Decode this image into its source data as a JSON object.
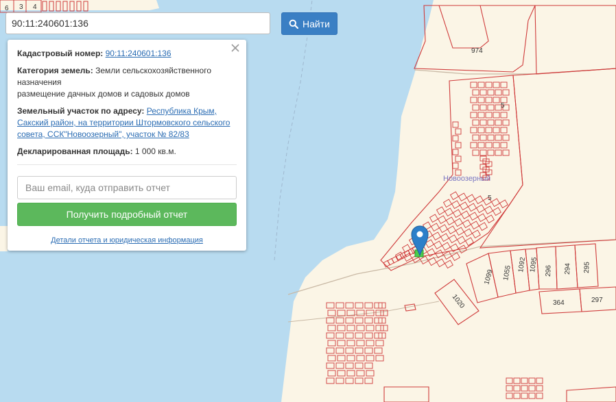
{
  "search": {
    "value": "90:11:240601:136",
    "button_label": "Найти"
  },
  "info": {
    "cadastral_label": "Кадастровый номер:",
    "cadastral_value": "90:11:240601:136",
    "category_label": "Категория земель:",
    "category_value": "Земли сельскохозяйственного назначения",
    "category_use": "размещение дачных домов и садовых домов",
    "address_label": "Земельный участок по адресу:",
    "address_value": "Республика Крым, Сакский район, на территории Штормовского сельского совета, ССК\"Новоозерный\", участок № 82/83",
    "area_label": "Декларированная площадь:",
    "area_value": "1 000 кв.м."
  },
  "report": {
    "email_placeholder": "Ваш email, куда отправить отчет",
    "button_label": "Получить подробный отчет",
    "details_link": "Детали отчета и юридическая информация"
  },
  "map": {
    "village_label": "Новоозерный",
    "top_left_labels": [
      "6",
      "3",
      "4"
    ],
    "parcel_labels": [
      "974",
      "5",
      "5",
      "1099",
      "1055",
      "1092",
      "1095",
      "296",
      "294",
      "295",
      "364",
      "297",
      "1020"
    ],
    "colors": {
      "water": "#b8dbf0",
      "land": "#fbf5e6",
      "parcel_line": "#cf3a3a",
      "marker": "#2c7fc9",
      "selected_parcel": "#4ccd4c",
      "road": "#c9b9a5"
    }
  }
}
